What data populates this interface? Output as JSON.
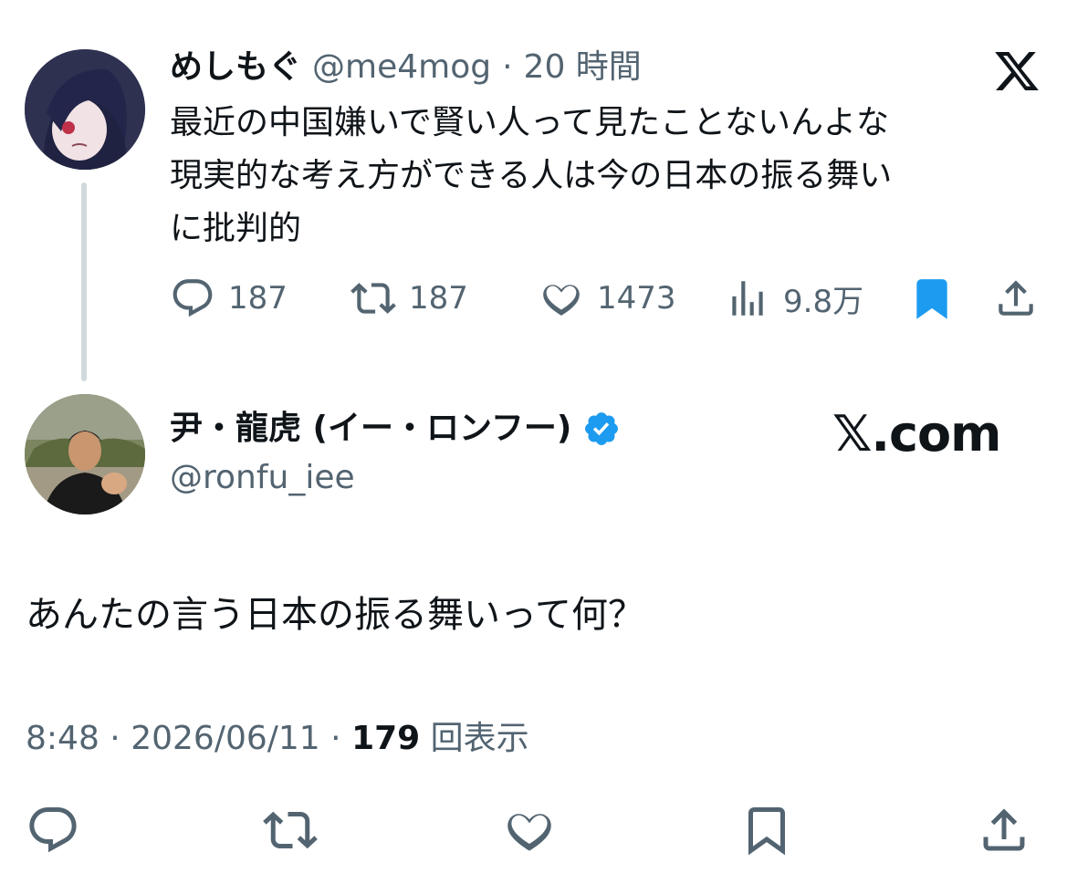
{
  "parent_tweet": {
    "display_name": "めしもぐ",
    "handle": "@me4mog",
    "separator": "·",
    "time_ago": "20 時間",
    "text": "最近の中国嫌いで賢い人って見たことないんよな\n現実的な考え方ができる人は今の日本の振る舞い\nに批判的",
    "metrics": {
      "replies": "187",
      "retweets": "187",
      "likes": "1473",
      "views": "9.8万"
    },
    "brand_icon": "x-logo-icon",
    "accent_color": "#1d9bf0"
  },
  "reply_tweet": {
    "display_name": "尹・龍虎 (イー・ロンフー)",
    "handle": "@ronfu_iee",
    "verified_icon": "verified-badge-icon",
    "watermark": "𝕏.com",
    "text": "あんたの言う日本の振る舞いって何？",
    "time": "8:48",
    "date": "2026/06/11",
    "meta_separator": "·",
    "views_count": "179",
    "views_label": "回表示"
  },
  "action_bar": {
    "icons": [
      "reply-icon",
      "retweet-icon",
      "like-icon",
      "bookmark-icon",
      "share-icon"
    ]
  }
}
